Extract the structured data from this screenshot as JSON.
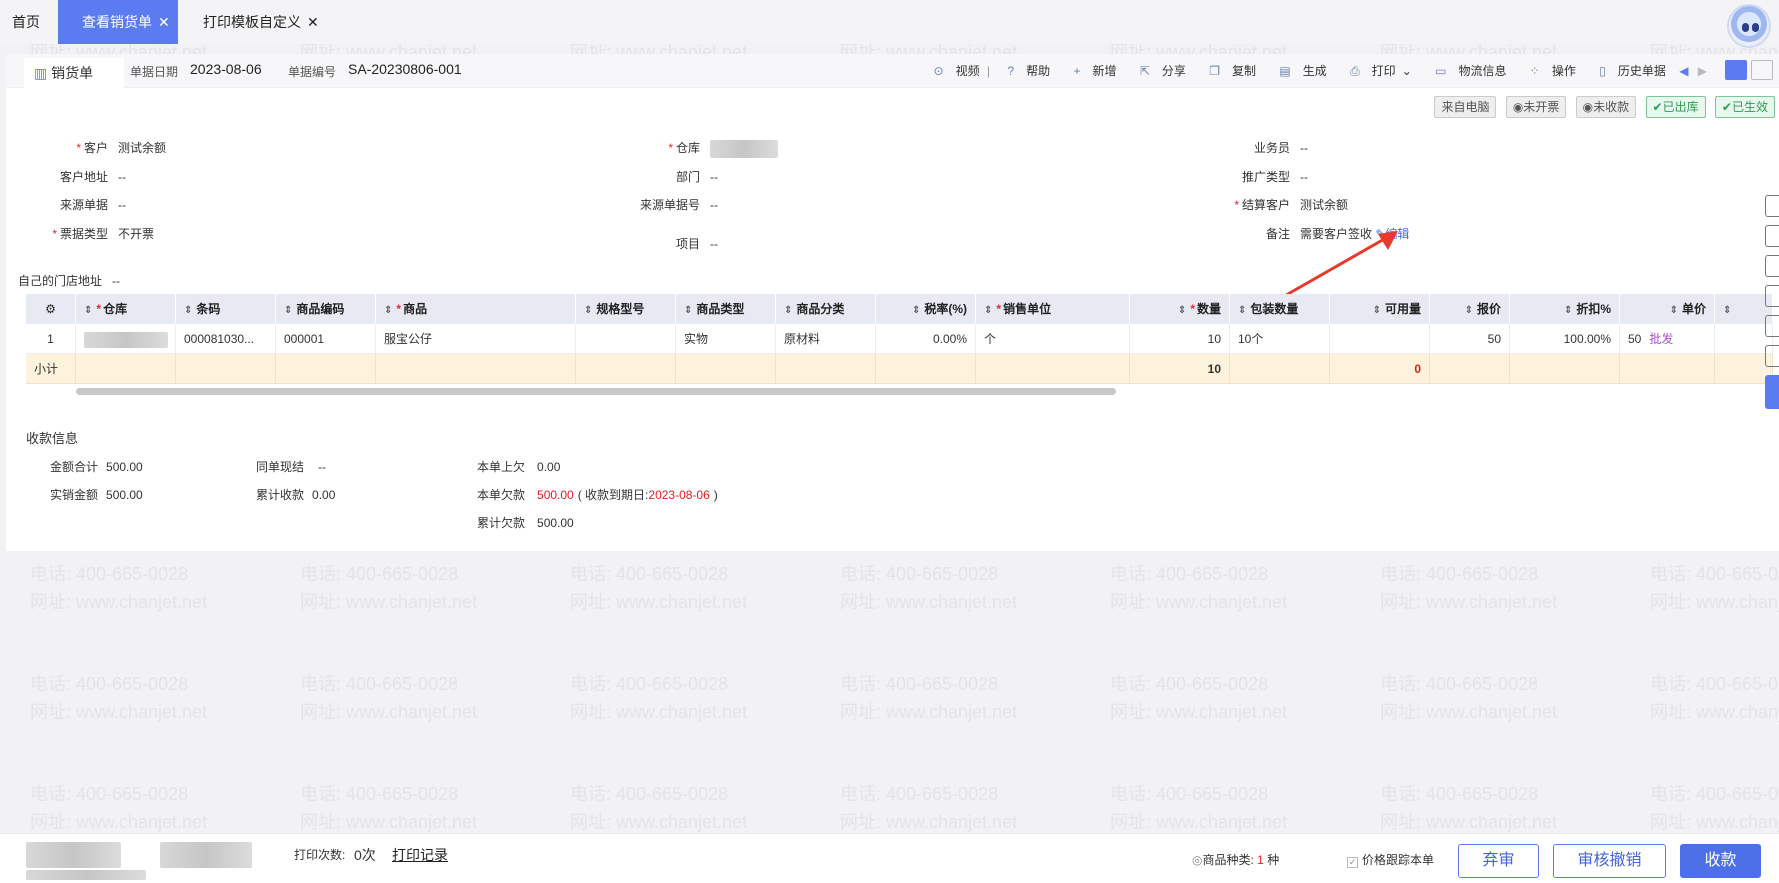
{
  "tabs": [
    {
      "label": "首页"
    },
    {
      "label": "查看销货单",
      "close": "✕"
    },
    {
      "label": "打印模板自定义",
      "close": "✕"
    }
  ],
  "header": {
    "doc_tab": "销货单",
    "date_label": "单据日期",
    "date_value": "2023-08-06",
    "no_label": "单据编号",
    "no_value": "SA-20230806-001"
  },
  "toolbar": {
    "video": "视频",
    "help": "帮助",
    "new": "新增",
    "share": "分享",
    "copy": "复制",
    "generate": "生成",
    "print": "打印",
    "logistics": "物流信息",
    "operate": "操作",
    "history": "历史单据"
  },
  "status_badges": [
    "来自电脑",
    "未开票",
    "未收款",
    "已出库",
    "已生效"
  ],
  "form": {
    "customer_label": "客户",
    "customer_value": "测试余额",
    "customer_addr_label": "客户地址",
    "customer_addr_value": "--",
    "source_doc_label": "来源单据",
    "source_doc_value": "--",
    "invoice_type_label": "票据类型",
    "invoice_type_value": "不开票",
    "store_addr_label": "自己的门店地址",
    "store_addr_value": "--",
    "warehouse_label": "仓库",
    "dept_label": "部门",
    "dept_value": "--",
    "source_no_label": "来源单据号",
    "source_no_value": "--",
    "project_label": "项目",
    "project_value": "--",
    "salesman_label": "业务员",
    "salesman_value": "--",
    "promo_label": "推广类型",
    "promo_value": "--",
    "settle_label": "结算客户",
    "settle_value": "测试余额",
    "remark_label": "备注",
    "remark_value": "需要客户签收",
    "edit_link": "编辑"
  },
  "table": {
    "headers": [
      "仓库",
      "条码",
      "商品编码",
      "商品",
      "规格型号",
      "商品类型",
      "商品分类",
      "税率(%)",
      "销售单位",
      "数量",
      "包装数量",
      "可用量",
      "报价",
      "折扣%",
      "单价"
    ],
    "row": {
      "index": "1",
      "barcode": "000081030...",
      "code": "000001",
      "product": "服宝公仔",
      "spec": "",
      "type": "实物",
      "category": "原材料",
      "tax": "0.00%",
      "unit": "个",
      "qty": "10",
      "pack_qty": "10个",
      "avail": "",
      "quote": "50",
      "discount": "100.00%",
      "price": "50",
      "price_tag": "批发"
    },
    "subtotal": {
      "label": "小计",
      "qty": "10",
      "avail": "0"
    }
  },
  "payment": {
    "title": "收款信息",
    "total_label": "金额合计",
    "total_value": "500.00",
    "actual_label": "实销金额",
    "actual_value": "500.00",
    "cash_label": "同单现结",
    "cash_value": "--",
    "acc_recv_label": "累计收款",
    "acc_recv_value": "0.00",
    "last_owe_label": "本单上欠",
    "last_owe_value": "0.00",
    "owe_label": "本单欠款",
    "owe_value": "500.00",
    "due_prefix": "( 收款到期日:",
    "due_date": "2023-08-06",
    "due_suffix": ")",
    "acc_owe_label": "累计欠款",
    "acc_owe_value": "500.00"
  },
  "footer": {
    "print_count_label": "打印次数:",
    "print_count_value": "0次",
    "print_record": "打印记录",
    "kinds_label": "商品种类:",
    "kinds_value": "1",
    "kinds_unit": "种",
    "price_follow": "价格跟踪本单",
    "abandon": "弃审",
    "revoke": "审核撤销",
    "collect": "收款"
  },
  "watermark": {
    "phone": "电话: 400-665-0028",
    "site": "网址: www.chanjet.net"
  },
  "colors": {
    "accent": "#5b7cf0",
    "red": "#e02020",
    "subtotal_bg": "#fdf2dc"
  }
}
